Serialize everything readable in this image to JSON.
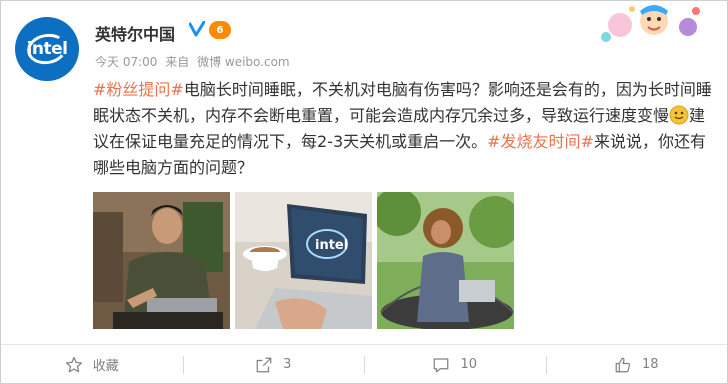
{
  "account": {
    "name": "英特尔中国",
    "avatar_text": "intel",
    "level_badge": "6",
    "time": "今天 07:00",
    "source_prefix": "来自",
    "source": "微博 weibo.com"
  },
  "post": {
    "hashtag1": "#粉丝提问#",
    "text1": "电脑长时间睡眠，不关机对电脑有伤害吗？影响还是会有的，因为长时间睡眠状态不关机，内存不会断电重置，可能会造成内存冗余过多，导致运行速度变慢",
    "text2": "建议在保证电量充足的情况下，每2-3天关机或重启一次。",
    "hashtag2": "#发烧友时间#",
    "text3": "来说说，你还有哪些电脑方面的问题？"
  },
  "images": [
    {
      "name": "man-with-laptop-photo"
    },
    {
      "name": "intel-laptop-coffee-photo",
      "logo_text": "intel"
    },
    {
      "name": "woman-in-swing-photo"
    }
  ],
  "actions": {
    "favorite_label": "收藏",
    "repost_count": "3",
    "comment_count": "10",
    "like_count": "18"
  },
  "colors": {
    "accent": "#eb7350",
    "brand": "#0c6fc1",
    "verified": "#1d8ff0"
  }
}
